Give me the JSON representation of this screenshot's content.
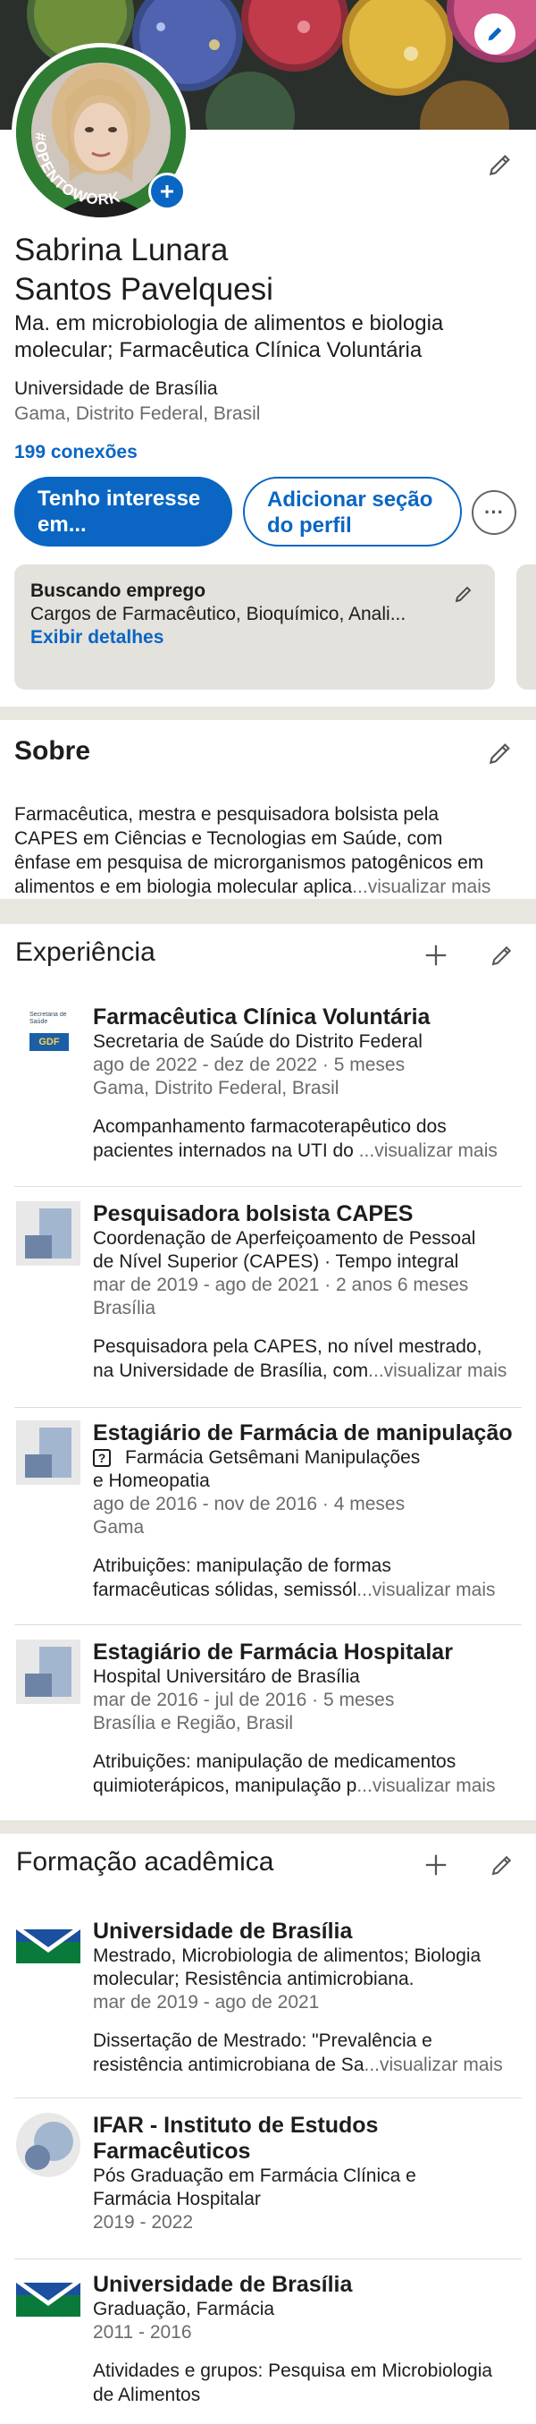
{
  "profile": {
    "name_line1": "Sabrina Lunara",
    "name_line2": "Santos Pavelquesi",
    "headline_line1": "Ma. em microbiologia de alimentos e biologia",
    "headline_line2": "molecular; Farmacêutica Clínica Voluntária",
    "university": "Universidade de Brasília",
    "location": "Gama, Distrito Federal, Brasil",
    "connections": "199 conexões",
    "open_to_work_badge": "#OPENTOWORK",
    "btn_interest_line1": "Tenho interesse",
    "btn_interest_line2": "em...",
    "btn_add_section_line1": "Adicionar seção",
    "btn_add_section_line2": "do perfil",
    "more_label": "···"
  },
  "open_to_work": {
    "title": "Buscando emprego",
    "roles": "Cargos de Farmacêutico, Bioquímico, Anali...",
    "details_link": "Exibir detalhes"
  },
  "about": {
    "heading": "Sobre",
    "line1": "Farmacêutica, mestra e pesquisadora bolsista pela",
    "line2": "CAPES em Ciências e Tecnologias em Saúde, com",
    "line3": "ênfase em pesquisa de microrganismos patogênicos em",
    "line4": "alimentos e em biologia molecular aplica",
    "more": "...visualizar mais"
  },
  "experience": {
    "heading": "Experiência",
    "items": [
      {
        "title": "Farmacêutica Clínica Voluntária",
        "org": "Secretaria de Saúde do Distrito Federal",
        "dates": "ago de 2022 - dez de 2022 · 5 meses",
        "place": "Gama, Distrito Federal, Brasil",
        "desc1": "Acompanhamento farmacoterapêutico dos",
        "desc2": "pacientes internados na UTI do ",
        "more": "...visualizar mais",
        "logo_text": "Secretaria de Saúde",
        "logo_badge": "GDF"
      },
      {
        "title": "Pesquisadora bolsista CAPES",
        "org1": "Coordenação de Aperfeiçoamento de Pessoal",
        "org2": "de Nível Superior (CAPES) · Tempo integral",
        "dates": "mar de 2019 - ago de 2021 · 2 anos 6 meses",
        "place": "Brasília",
        "desc1": "Pesquisadora pela CAPES, no nível mestrado,",
        "desc2": "na Universidade de Brasília, com",
        "more": "...visualizar mais"
      },
      {
        "title": "Estagiário de Farmácia de manipulação",
        "org1": "Farmácia Getsêmani Manipulações",
        "org2": "e Homeopatia",
        "dates": "ago de 2016 - nov de 2016 · 4 meses",
        "place": "Gama",
        "desc1": "Atribuições: manipulação de formas",
        "desc2": "farmacêuticas sólidas, semissól",
        "more": "...visualizar mais"
      },
      {
        "title": "Estagiário de Farmácia Hospitalar",
        "org": "Hospital Universitáro de Brasília",
        "dates": "mar de 2016 - jul de 2016 · 5 meses",
        "place": "Brasília e Região, Brasil",
        "desc1": "Atribuições: manipulação de medicamentos",
        "desc2": "quimioterápicos, manipulação p",
        "more": "...visualizar mais"
      }
    ]
  },
  "education": {
    "heading": "Formação acadêmica",
    "items": [
      {
        "school": "Universidade de Brasília",
        "degree1": "Mestrado, Microbiologia de alimentos; Biologia",
        "degree2": "molecular; Resistência antimicrobiana.",
        "dates": "mar de 2019 - ago de 2021",
        "desc1": "Dissertação de Mestrado: \"Prevalência e",
        "desc2": "resistência antimicrobiana de Sa",
        "more": "...visualizar mais"
      },
      {
        "school1": "IFAR - Instituto de Estudos",
        "school2": "Farmacêuticos",
        "degree1": "Pós Graduação em Farmácia Clínica e",
        "degree2": "Farmácia Hospitalar",
        "dates": "2019 - 2022"
      },
      {
        "school": "Universidade de Brasília",
        "degree": "Graduação, Farmácia",
        "dates": "2011 - 2016",
        "desc1": "Atividades e grupos: Pesquisa em Microbiologia",
        "desc2": "de Alimentos"
      }
    ]
  },
  "colors": {
    "accent_blue": "#0a66c2",
    "open_to_work_green": "#2e7d32",
    "primary_button": "#0a66c2"
  }
}
